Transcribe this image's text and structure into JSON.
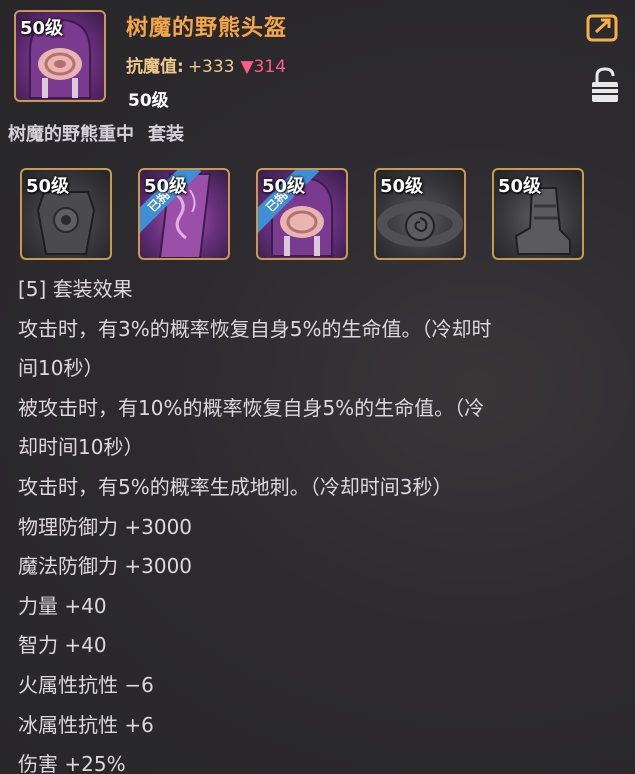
{
  "item": {
    "level_badge": "50级",
    "name": "树魔的野熊头盔",
    "resist_label": "抗魔值:",
    "resist_value": "+333",
    "resist_diff": "▼314",
    "level_text": "50级"
  },
  "set": {
    "name": "树魔的野熊重中",
    "type": "套装",
    "pieces": [
      {
        "level": "50级",
        "owned": false,
        "owned_label": ""
      },
      {
        "level": "50级",
        "owned": true,
        "owned_label": "已拥有"
      },
      {
        "level": "50级",
        "owned": true,
        "owned_label": "已拥有"
      },
      {
        "level": "50级",
        "owned": false,
        "owned_label": ""
      },
      {
        "level": "50级",
        "owned": false,
        "owned_label": ""
      }
    ],
    "effect_header": "[5] 套装效果",
    "effect_lines": [
      "攻击时，有3%的概率恢复自身5%的生命值。（冷却时",
      "间10秒）",
      "被攻击时，有10%的概率恢复自身5%的生命值。（冷",
      "却时间10秒）",
      "攻击时，有5%的概率生成地刺。（冷却时间3秒）",
      "物理防御力 +3000",
      "魔法防御力 +3000",
      "力量 +40",
      "智力 +40",
      "火属性抗性 −6",
      "冰属性抗性 +6",
      "伤害 +25%"
    ]
  },
  "icons": {
    "share": "share-icon",
    "lock": "unlock-icon"
  },
  "colors": {
    "title": "#f3a64a",
    "frame": "#c79a52",
    "decrease": "#ff5b86",
    "owned_ribbon": "#3f8fd6"
  }
}
